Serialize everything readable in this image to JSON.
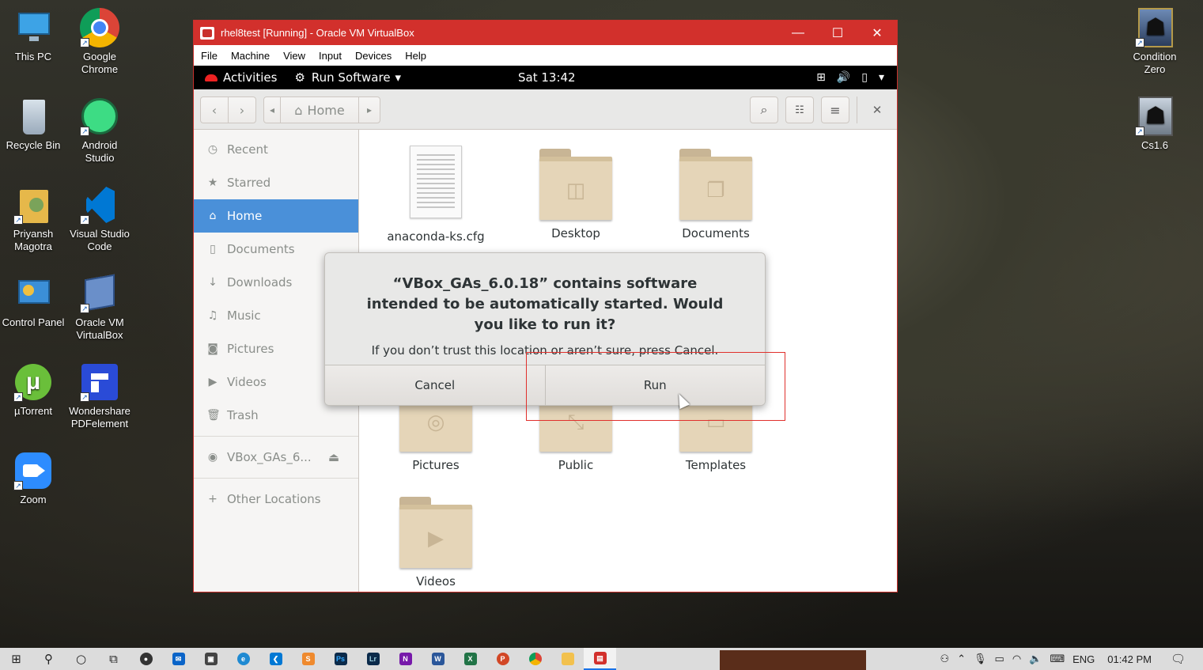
{
  "desktop": {
    "left_icons": [
      {
        "label": "This PC"
      },
      {
        "label": "Google Chrome"
      },
      {
        "label": "Recycle Bin"
      },
      {
        "label": "Android Studio"
      },
      {
        "label": "Priyansh Magotra"
      },
      {
        "label": "Visual Studio Code"
      },
      {
        "label": "Control Panel"
      },
      {
        "label": "Oracle VM VirtualBox"
      },
      {
        "label": "µTorrent"
      },
      {
        "label": "Wondershare PDFelement"
      },
      {
        "label": "Zoom"
      }
    ],
    "right_icons": [
      {
        "label": "Condition Zero"
      },
      {
        "label": "Cs1.6"
      }
    ]
  },
  "vbox": {
    "title": "rhel8test [Running] - Oracle VM VirtualBox",
    "menu": [
      "File",
      "Machine",
      "View",
      "Input",
      "Devices",
      "Help"
    ],
    "minimize": "—",
    "maximize": "☐",
    "close": "✕"
  },
  "gnome": {
    "activities": "Activities",
    "app_menu": "Run Software",
    "app_menu_arrow": "▾",
    "clock": "Sat 13:42"
  },
  "nautilus": {
    "path_home": "Home",
    "sidebar": [
      {
        "icon": "clock-icon",
        "glyph": "◷",
        "label": "Recent"
      },
      {
        "icon": "star-icon",
        "glyph": "★",
        "label": "Starred"
      },
      {
        "icon": "home-icon",
        "glyph": "⌂",
        "label": "Home"
      },
      {
        "icon": "document-icon",
        "glyph": "▯",
        "label": "Documents"
      },
      {
        "icon": "download-icon",
        "glyph": "↓",
        "label": "Downloads"
      },
      {
        "icon": "music-icon",
        "glyph": "♫",
        "label": "Music"
      },
      {
        "icon": "camera-icon",
        "glyph": "◙",
        "label": "Pictures"
      },
      {
        "icon": "video-icon",
        "glyph": "▶",
        "label": "Videos"
      },
      {
        "icon": "trash-icon",
        "glyph": "🗑",
        "label": "Trash"
      }
    ],
    "mounted_drive": "VBox_GAs_6...",
    "other_locations": "Other Locations",
    "files": [
      {
        "label": "anaconda-ks.cfg",
        "kind": "document"
      },
      {
        "label": "Desktop",
        "kind": "folder",
        "emblem": "◫"
      },
      {
        "label": "Documents",
        "kind": "folder",
        "emblem": "❐"
      },
      {
        "label": "Pictures",
        "kind": "folder",
        "emblem": "◎"
      },
      {
        "label": "Public",
        "kind": "folder",
        "emblem": "⤡"
      },
      {
        "label": "Templates",
        "kind": "folder",
        "emblem": "▭"
      },
      {
        "label": "Videos",
        "kind": "folder",
        "emblem": "▶"
      }
    ]
  },
  "dialog": {
    "message": "“VBox_GAs_6.0.18” contains software intended to be automatically started. Would you like to run it?",
    "subtext": "If you don’t trust this location or aren’t sure, press Cancel.",
    "cancel": "Cancel",
    "run": "Run"
  },
  "taskbar": {
    "language": "ENG",
    "time": "01:42 PM"
  },
  "colors": {
    "vbox_title": "#d2302c",
    "selection": "#4a90d9",
    "highlight_box": "#e0302c"
  }
}
